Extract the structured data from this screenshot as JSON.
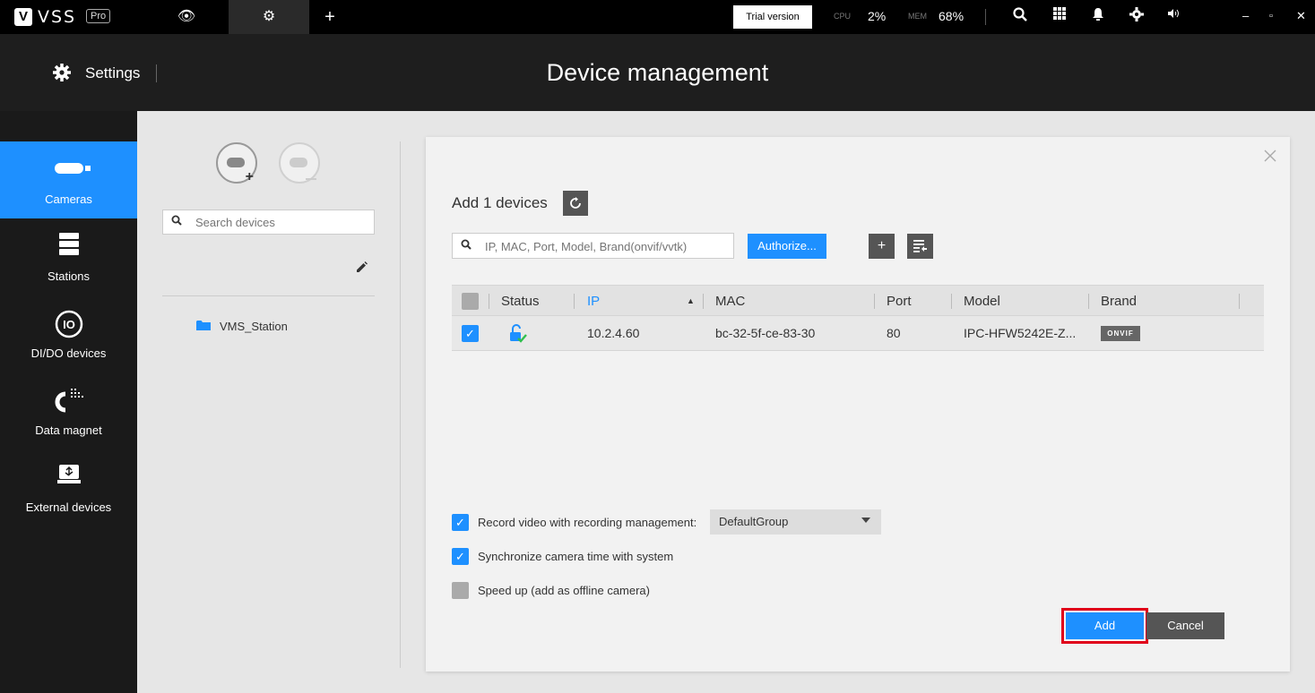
{
  "topbar": {
    "logo_mark": "V",
    "app_name": "VSS",
    "edition": "Pro",
    "tabs": [
      {
        "icon": "eye-icon",
        "glyph": "👁"
      },
      {
        "icon": "gear-icon",
        "glyph": "⚙"
      },
      {
        "icon": "plus-icon",
        "glyph": "+"
      }
    ],
    "trial_label": "Trial version",
    "cpu_label": "CPU",
    "cpu_value": "2%",
    "mem_label": "MEM",
    "mem_value": "68%",
    "icons": [
      "search-icon",
      "grid-icon",
      "bell-icon",
      "gear-icon",
      "volume-icon"
    ],
    "window_controls": [
      "–",
      "▫",
      "✕"
    ]
  },
  "header": {
    "settings_label": "Settings",
    "page_title": "Device management"
  },
  "sidebar": {
    "items": [
      {
        "label": "Cameras",
        "icon": "camera-icon",
        "active": true
      },
      {
        "label": "Stations",
        "icon": "server-icon",
        "active": false
      },
      {
        "label": "DI/DO devices",
        "icon": "io-icon",
        "active": false
      },
      {
        "label": "Data magnet",
        "icon": "magnet-icon",
        "active": false
      },
      {
        "label": "External devices",
        "icon": "usb-icon",
        "active": false
      }
    ]
  },
  "tree": {
    "search_placeholder": "Search devices",
    "station_name": "VMS_Station"
  },
  "dialog": {
    "title": "Add 1 devices",
    "search_placeholder": "IP, MAC, Port, Model, Brand(onvif/vvtk)",
    "authorize_label": "Authorize...",
    "columns": {
      "status": "Status",
      "ip": "IP",
      "mac": "MAC",
      "port": "Port",
      "model": "Model",
      "brand": "Brand"
    },
    "rows": [
      {
        "checked": true,
        "status": "unlocked-verified",
        "ip": "10.2.4.60",
        "mac": "bc-32-5f-ce-83-30",
        "port": "80",
        "model": "IPC-HFW5242E-Z...",
        "brand": "ONVIF"
      }
    ],
    "options": {
      "record_label": "Record video with recording management:",
      "record_checked": true,
      "record_group": "DefaultGroup",
      "sync_label": "Synchronize camera time with system",
      "sync_checked": true,
      "speedup_label": "Speed up (add as offline camera)",
      "speedup_checked": false
    },
    "add_label": "Add",
    "cancel_label": "Cancel"
  },
  "colors": {
    "accent": "#1e90ff",
    "highlight": "#e0001a",
    "dark_button": "#555555"
  }
}
